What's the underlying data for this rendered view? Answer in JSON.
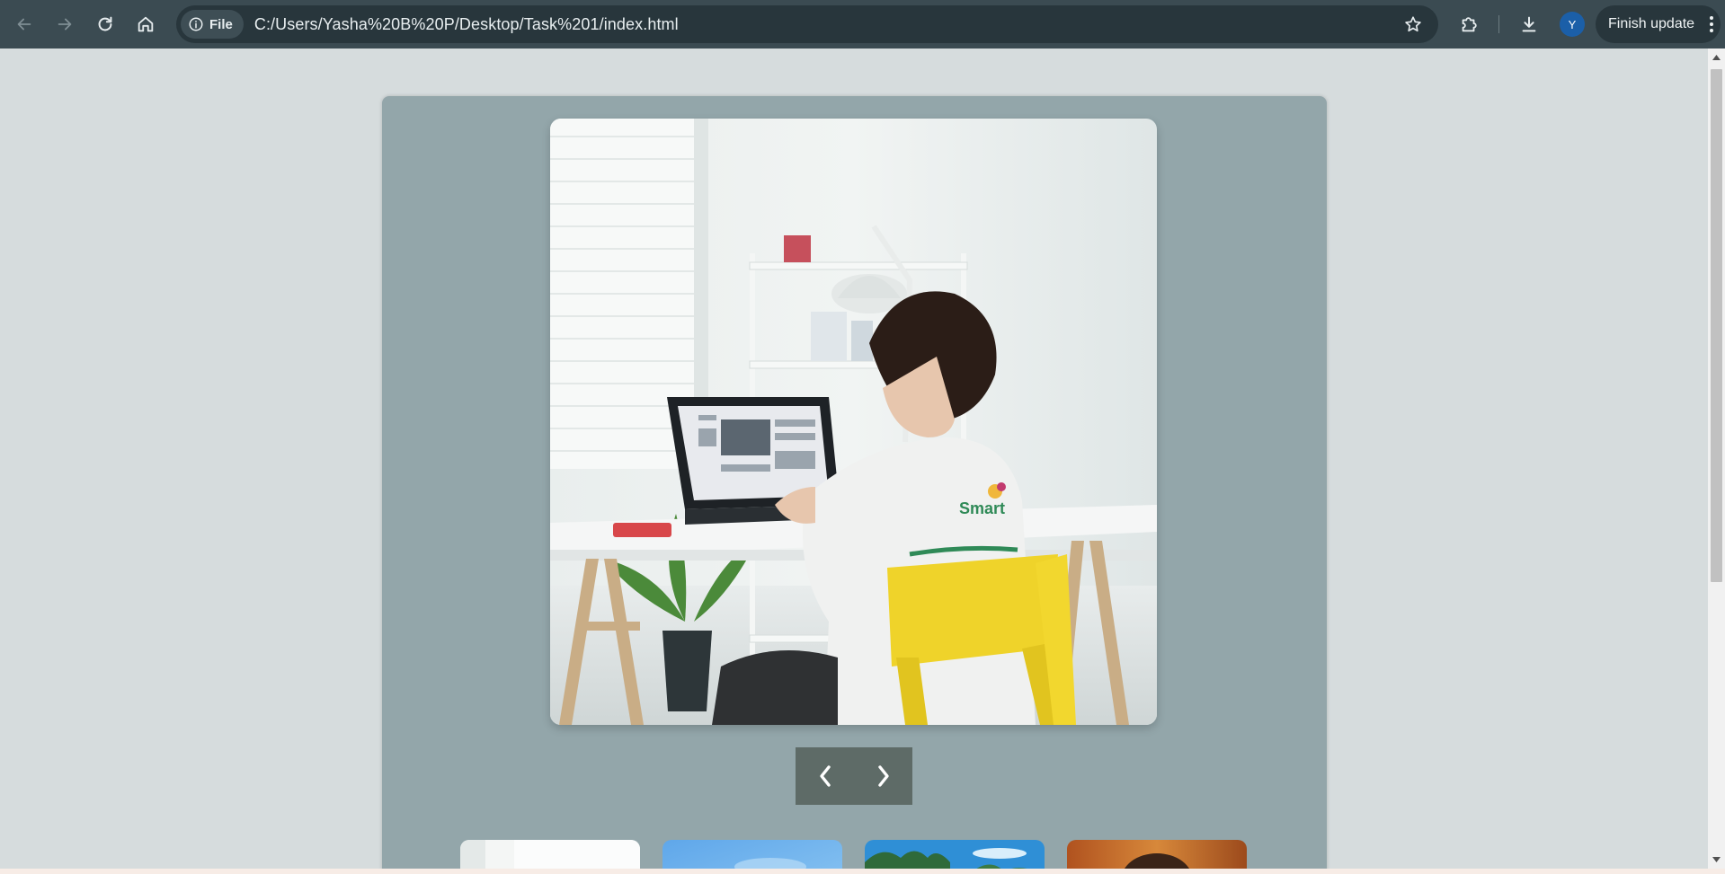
{
  "browser": {
    "site_chip_label": "File",
    "url": "C:/Users/Yasha%20B%20P/Desktop/Task%201/index.html",
    "profile_initial": "Y",
    "finish_update_label": "Finish update"
  },
  "gallery": {
    "main_image_icon": "photo-person-at-desk-with-laptop",
    "shirt_print": "Smart",
    "prev_icon": "chevron-left-icon",
    "next_icon": "chevron-right-icon",
    "thumbnails": [
      {
        "icon": "thumbnail-white-room"
      },
      {
        "icon": "thumbnail-blue-sky"
      },
      {
        "icon": "thumbnail-trees-sky"
      },
      {
        "icon": "thumbnail-autumn-portrait"
      }
    ]
  },
  "colors": {
    "toolbar": "#3b4b52",
    "omnibox": "#28363c",
    "page_background": "#d6dcdd",
    "gallery_panel": "#93a6aa",
    "nav_controls": "#5e6b67",
    "avatar": "#1b5fa8"
  }
}
